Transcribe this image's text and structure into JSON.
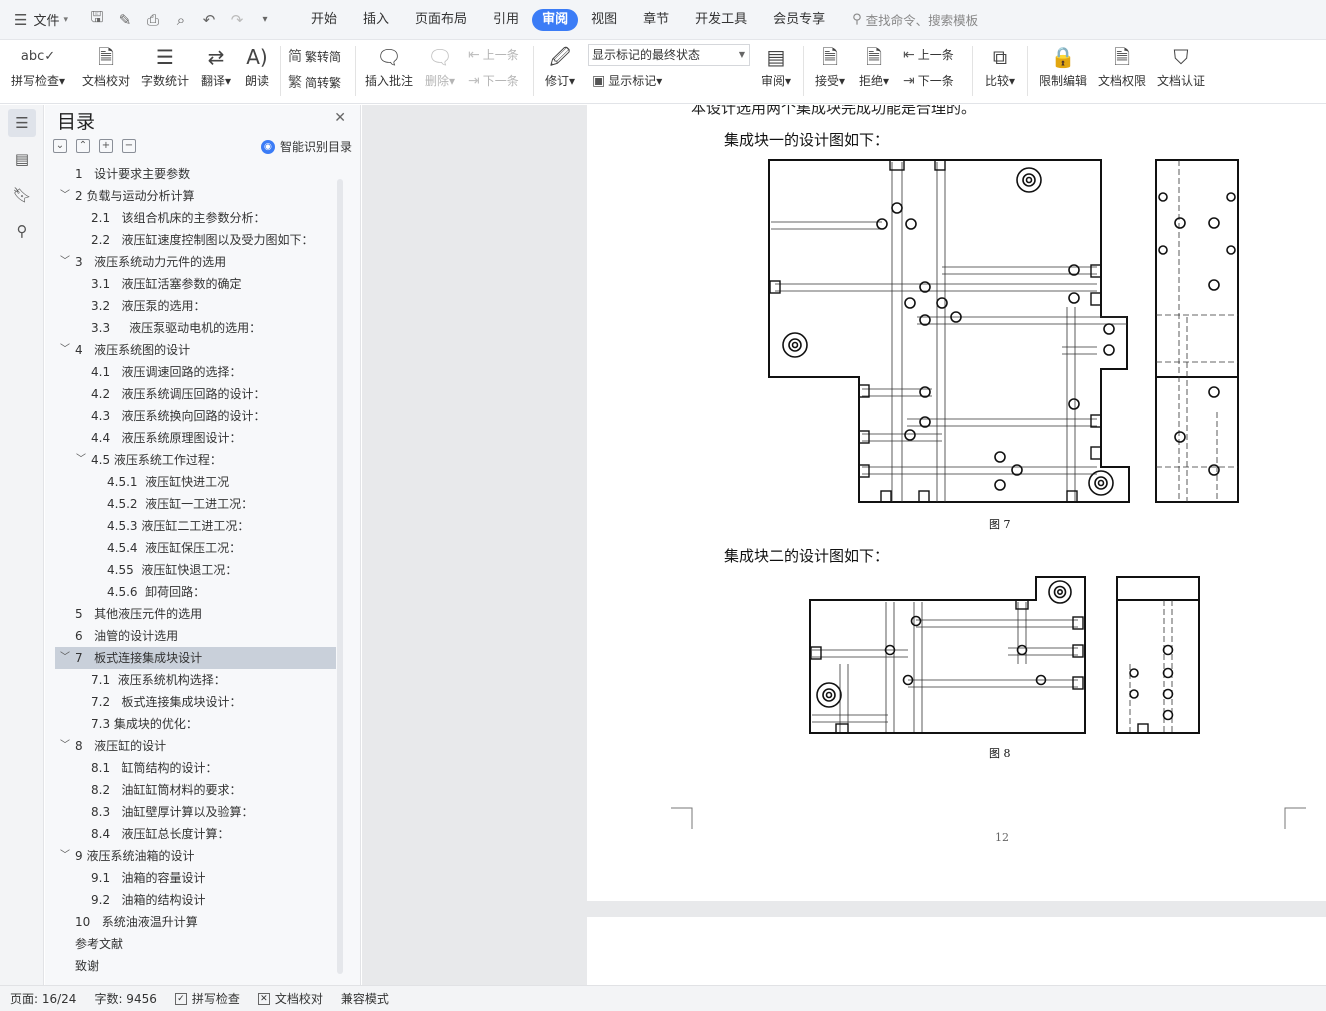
{
  "menubar": {
    "file_label": "文件",
    "tabs": [
      "开始",
      "插入",
      "页面布局",
      "引用",
      "审阅",
      "视图",
      "章节",
      "开发工具",
      "会员专享"
    ],
    "active_tab": "审阅",
    "search_placeholder": "查找命令、搜索模板"
  },
  "ribbon": {
    "spell_check": "拼写检查",
    "doc_proof": "文档校对",
    "word_count": "字数统计",
    "translate": "翻译",
    "read_aloud": "朗读",
    "trad_to_simp": "繁转简",
    "simp_to_trad": "简转繁",
    "insert_comment": "插入批注",
    "delete": "删除",
    "prev_comment": "上一条",
    "next_comment": "下一条",
    "track_changes": "修订",
    "display_state": "显示标记的最终状态",
    "show_markup": "显示标记",
    "review": "审阅",
    "accept": "接受",
    "reject": "拒绝",
    "prev_change": "上一条",
    "next_change": "下一条",
    "compare": "比较",
    "restrict_edit": "限制编辑",
    "doc_permission": "文档权限",
    "doc_cert": "文档认证"
  },
  "toc": {
    "title": "目录",
    "smart_label": "智能识别目录",
    "items": [
      {
        "text": "1   设计要求主要参数",
        "indent": 1,
        "twisty": ""
      },
      {
        "text": "2 负载与运动分析计算",
        "indent": 1,
        "twisty": "v"
      },
      {
        "text": "2.1   该组合机床的主参数分析：",
        "indent": 2,
        "twisty": ""
      },
      {
        "text": "2.2   液压缸速度控制图以及受力图如下：",
        "indent": 2,
        "twisty": ""
      },
      {
        "text": "3   液压系统动力元件的选用",
        "indent": 1,
        "twisty": "v"
      },
      {
        "text": "3.1   液压缸活塞参数的确定",
        "indent": 2,
        "twisty": ""
      },
      {
        "text": "3.2   液压泵的选用：",
        "indent": 2,
        "twisty": ""
      },
      {
        "text": "3.3     液压泵驱动电机的选用：",
        "indent": 2,
        "twisty": ""
      },
      {
        "text": "4   液压系统图的设计",
        "indent": 1,
        "twisty": "v"
      },
      {
        "text": "4.1   液压调速回路的选择：",
        "indent": 2,
        "twisty": ""
      },
      {
        "text": "4.2   液压系统调压回路的设计：",
        "indent": 2,
        "twisty": ""
      },
      {
        "text": "4.3   液压系统换向回路的设计：",
        "indent": 2,
        "twisty": ""
      },
      {
        "text": "4.4   液压系统原理图设计：",
        "indent": 2,
        "twisty": ""
      },
      {
        "text": "4.5 液压系统工作过程：",
        "indent": 2,
        "twisty": "v"
      },
      {
        "text": "4.5.1  液压缸快进工况",
        "indent": 3,
        "twisty": ""
      },
      {
        "text": "4.5.2  液压缸一工进工况：",
        "indent": 3,
        "twisty": ""
      },
      {
        "text": "4.5.3 液压缸二工进工况：",
        "indent": 3,
        "twisty": ""
      },
      {
        "text": "4.5.4  液压缸保压工况：",
        "indent": 3,
        "twisty": ""
      },
      {
        "text": "4.55  液压缸快退工况：",
        "indent": 3,
        "twisty": ""
      },
      {
        "text": "4.5.6  卸荷回路：",
        "indent": 3,
        "twisty": ""
      },
      {
        "text": "5   其他液压元件的选用",
        "indent": 1,
        "twisty": ""
      },
      {
        "text": "6   油管的设计选用",
        "indent": 1,
        "twisty": ""
      },
      {
        "text": "7   板式连接集成块设计",
        "indent": 1,
        "twisty": "v",
        "selected": true
      },
      {
        "text": "7.1  液压系统机构选择：",
        "indent": 2,
        "twisty": ""
      },
      {
        "text": "7.2   板式连接集成块设计：",
        "indent": 2,
        "twisty": ""
      },
      {
        "text": "7.3 集成块的优化：",
        "indent": 2,
        "twisty": ""
      },
      {
        "text": "8   液压缸的设计",
        "indent": 1,
        "twisty": "v"
      },
      {
        "text": "8.1   缸筒结构的设计：",
        "indent": 2,
        "twisty": ""
      },
      {
        "text": "8.2   油缸缸筒材料的要求：",
        "indent": 2,
        "twisty": ""
      },
      {
        "text": "8.3   油缸壁厚计算以及验算：",
        "indent": 2,
        "twisty": ""
      },
      {
        "text": "8.4   液压缸总长度计算：",
        "indent": 2,
        "twisty": ""
      },
      {
        "text": "9 液压系统油箱的设计",
        "indent": 1,
        "twisty": "v"
      },
      {
        "text": "9.1   油箱的容量设计",
        "indent": 2,
        "twisty": ""
      },
      {
        "text": "9.2   油箱的结构设计",
        "indent": 2,
        "twisty": ""
      },
      {
        "text": "10   系统油液温升计算",
        "indent": 1,
        "twisty": ""
      },
      {
        "text": "参考文献",
        "indent": 1,
        "twisty": ""
      },
      {
        "text": "致谢",
        "indent": 1,
        "twisty": ""
      }
    ]
  },
  "document": {
    "line_top": "本设计选用两个集成块完成功能是合理的。",
    "block1_intro": "集成块一的设计图如下：",
    "fig7_caption": "图 7",
    "block2_intro": "集成块二的设计图如下：",
    "fig8_caption": "图 8",
    "page_number": "12"
  },
  "status": {
    "page": "页面: 16/24",
    "words": "字数: 9456",
    "spell_check": "拼写检查",
    "doc_proof": "文档校对",
    "compat_mode": "兼容模式"
  },
  "colors": {
    "accent": "#3b7cf6",
    "toc_selected": "#c9d0da"
  }
}
